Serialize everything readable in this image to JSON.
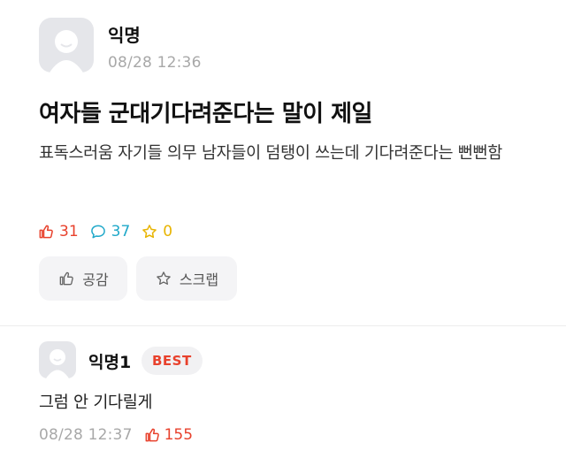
{
  "post": {
    "author": "익명",
    "date": "08/28 12:36",
    "title": "여자들 군대기다려준다는 말이 제일",
    "body": "표독스러움 자기들 의무 남자들이 덤탱이 쓰는데 기다려준다는 뻔뻔함",
    "likes": "31",
    "comments": "37",
    "scraps": "0",
    "like_button": "공감",
    "scrap_button": "스크랩"
  },
  "comment": {
    "author": "익명1",
    "badge": "BEST",
    "text": "그럼 안 기다릴게",
    "date": "08/28 12:37",
    "likes": "155"
  },
  "colors": {
    "like": "#e8412c",
    "comment": "#1fa8c9",
    "star": "#e8b400",
    "muted": "#a8a8a8",
    "button_bg": "#f4f4f6"
  }
}
